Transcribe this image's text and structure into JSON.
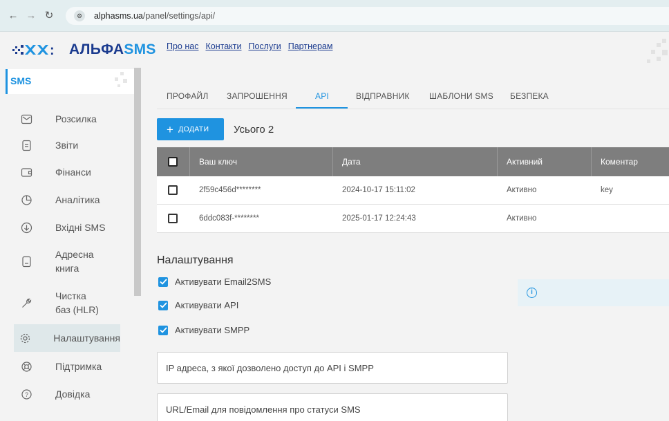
{
  "browser": {
    "url_domain": "alphasms.ua",
    "url_path": "/panel/settings/api/"
  },
  "header": {
    "logo_text_1": "АЛЬФА",
    "logo_text_2": "SMS",
    "nav": [
      "Про нас",
      "Контакти",
      "Послуги",
      "Партнерам"
    ]
  },
  "sidebar": {
    "section": "SMS",
    "items": [
      {
        "label": "Розсилка",
        "icon": "mail-icon"
      },
      {
        "label": "Звіти",
        "icon": "document-icon"
      },
      {
        "label": "Фінанси",
        "icon": "wallet-icon"
      },
      {
        "label": "Аналітика",
        "icon": "pie-chart-icon"
      },
      {
        "label": "Вхідні SMS",
        "icon": "inbox-down-icon"
      },
      {
        "label": "Адресна книга",
        "icon": "address-book-icon"
      },
      {
        "label": "Чистка баз (HLR)",
        "icon": "wrench-icon"
      },
      {
        "label": "Налаштування",
        "icon": "gear-icon"
      },
      {
        "label": "Підтримка",
        "icon": "lifebuoy-icon"
      },
      {
        "label": "Довідка",
        "icon": "help-icon"
      }
    ],
    "active_index": 7
  },
  "tabs": {
    "items": [
      "ПРОФАЙЛ",
      "ЗАПРОШЕННЯ",
      "API",
      "ВІДПРАВНИК",
      "ШАБЛОНИ SMS",
      "БЕЗПЕКА"
    ],
    "active": "API"
  },
  "toolbar": {
    "add_label": "ДОДАТИ",
    "total_label": "Усього 2"
  },
  "table": {
    "columns": [
      "Ваш ключ",
      "Дата",
      "Активний",
      "Коментар"
    ],
    "rows": [
      {
        "key": "2f59c456d********",
        "date": "2024-10-17 15:11:02",
        "active": "Активно",
        "comment": "key"
      },
      {
        "key": "6ddc083f-********",
        "date": "2025-01-17 12:24:43",
        "active": "Активно",
        "comment": ""
      }
    ]
  },
  "settings": {
    "title": "Налаштування",
    "checkboxes": [
      {
        "label": "Активувати Email2SMS",
        "checked": true
      },
      {
        "label": "Активувати API",
        "checked": true
      },
      {
        "label": "Активувати SMPP",
        "checked": true
      }
    ],
    "ip_placeholder": "IP адреса, з якої дозволено доступ до API і SMPP",
    "url_placeholder": "URL/Email для повідомлення про статуси SMS"
  },
  "colors": {
    "accent": "#1f93e0",
    "brand_dark": "#1b3b8f",
    "table_header": "#7e7e7e"
  }
}
